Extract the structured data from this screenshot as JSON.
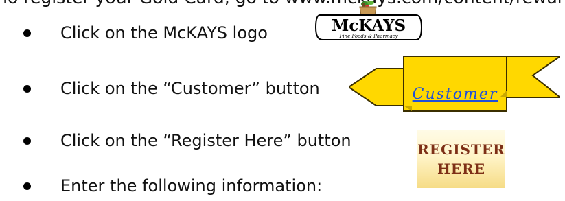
{
  "intro_text": "To register your Gold Card, go to www.mckays.com/content/reward",
  "steps": [
    {
      "text": "Click on the McKAYS logo"
    },
    {
      "text": "Click on the “Customer” button"
    },
    {
      "text": "Click on the “Register Here” button"
    },
    {
      "text": "Enter the following information:"
    }
  ],
  "logo": {
    "brand": "McKAYS",
    "tagline": "Fine Foods & Pharmacy",
    "icon": "grocery-bag-icon"
  },
  "customer_button": {
    "label": "Customer",
    "color": "#ffd800",
    "text_color": "#1f4fd9"
  },
  "register_button": {
    "line1": "REGISTER",
    "line2": "HERE",
    "text_color": "#7d2f16"
  }
}
